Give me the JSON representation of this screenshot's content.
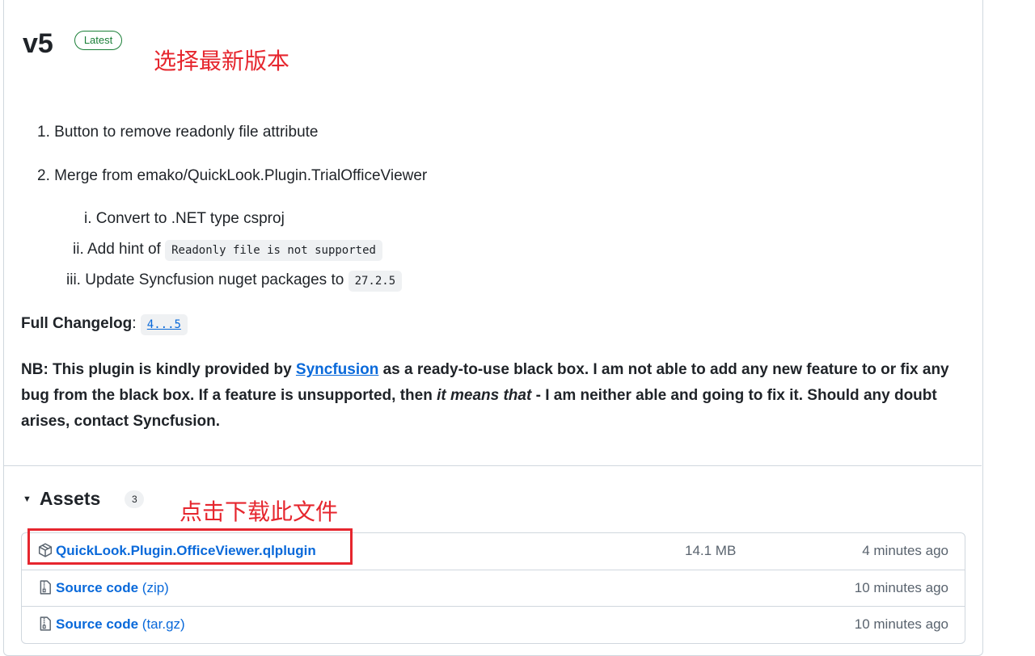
{
  "release": {
    "title": "v5",
    "badge": "Latest"
  },
  "annotations": {
    "top": "选择最新版本",
    "assets": "点击下载此文件"
  },
  "notes": {
    "items": [
      {
        "marker": "1.",
        "text": "Button to remove readonly file attribute"
      },
      {
        "marker": "2.",
        "text": "Merge from emako/QuickLook.Plugin.TrialOfficeViewer"
      }
    ],
    "subitems": [
      {
        "marker": "i.",
        "text": "Convert to .NET type csproj",
        "code": ""
      },
      {
        "marker": "ii.",
        "text": "Add hint of",
        "code": "Readonly file is not supported"
      },
      {
        "marker": "iii.",
        "text": "Update Syncfusion nuget packages to",
        "code": "27.2.5"
      }
    ]
  },
  "changelog": {
    "label": "Full Changelog",
    "colon": ":",
    "link": "4...5"
  },
  "nb": {
    "part1": "NB: This plugin is kindly provided by",
    "link": "Syncfusion",
    "part2": "as a ready-to-use black box. I am not able to add any new feature to or fix any bug from the black box. If a feature is unsupported, then",
    "italic": "it means that",
    "part3": "- I am neither able and going to fix it. Should any doubt arises, contact Syncfusion."
  },
  "assets": {
    "title": "Assets",
    "count": "3",
    "rows": [
      {
        "name": "QuickLook.Plugin.OfficeViewer.qlplugin",
        "ext": "",
        "size": "14.1 MB",
        "time": "4 minutes ago",
        "icon": "package-icon"
      },
      {
        "name": "Source code",
        "ext": "(zip)",
        "size": "",
        "time": "10 minutes ago",
        "icon": "file-zip-icon"
      },
      {
        "name": "Source code",
        "ext": "(tar.gz)",
        "size": "",
        "time": "10 minutes ago",
        "icon": "file-zip-icon"
      }
    ]
  },
  "colors": {
    "link": "#0969da",
    "annotation": "#e6262e",
    "badge": "#1a7f37",
    "border": "#d0d7de"
  }
}
